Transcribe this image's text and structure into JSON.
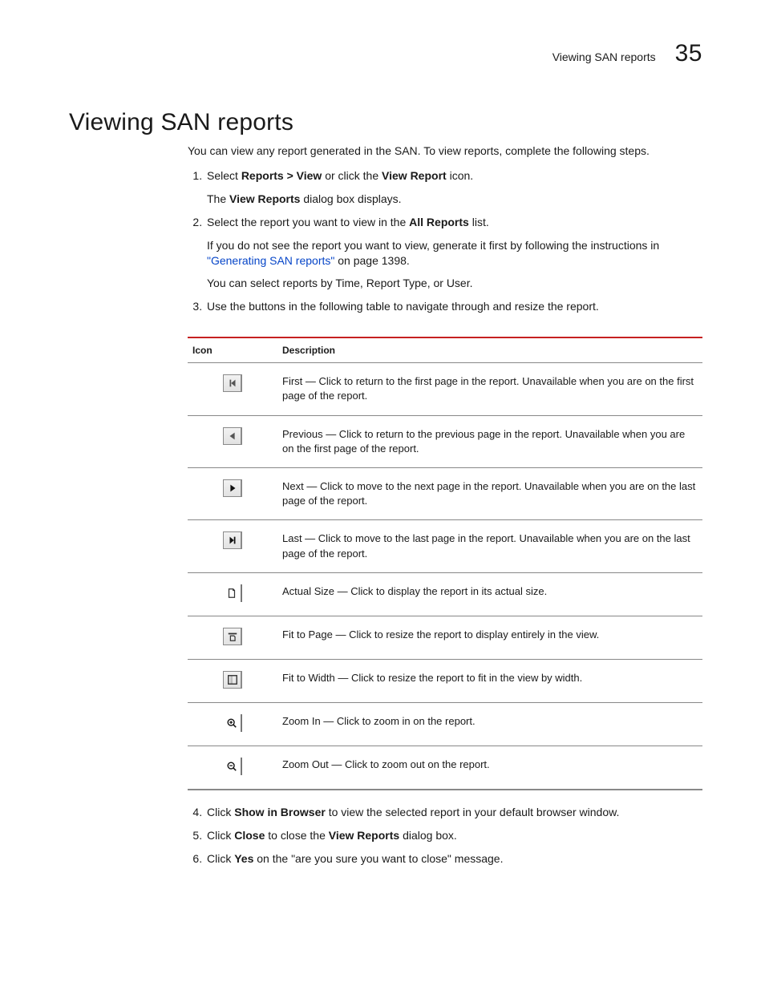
{
  "header": {
    "running_head": "Viewing SAN reports",
    "chapter_number": "35"
  },
  "title": "Viewing SAN reports",
  "intro": "You can view any report generated in the SAN. To view reports, complete the following steps.",
  "steps_part1": {
    "s1_a": "Select ",
    "s1_b": "Reports > View",
    "s1_c": " or click the ",
    "s1_d": "View Report",
    "s1_e": " icon.",
    "s1_f": "The ",
    "s1_g": "View Reports",
    "s1_h": " dialog box displays.",
    "s2_a": "Select the report you want to view in the ",
    "s2_b": "All Reports",
    "s2_c": " list.",
    "s2_d": "If you do not see the report you want to view, generate it first by following the instructions in ",
    "s2_link": "\"Generating SAN reports\"",
    "s2_e": " on page 1398.",
    "s2_f": "You can select reports by Time, Report Type, or User.",
    "s3": "Use the buttons in the following table to navigate through and resize the report."
  },
  "table": {
    "head_icon": "Icon",
    "head_desc": "Description",
    "rows": [
      {
        "icon": "first",
        "desc": "First — Click to return to the first page in the report. Unavailable when you are on the first page of the report."
      },
      {
        "icon": "previous",
        "desc": "Previous — Click to return to the previous page in the report. Unavailable when you are on the first page of the report."
      },
      {
        "icon": "next",
        "desc": "Next — Click to move to the next page in the report. Unavailable when you are on the last page of the report."
      },
      {
        "icon": "last",
        "desc": "Last — Click to move to the last page in the report. Unavailable when you are on the last page of the report."
      },
      {
        "icon": "actual",
        "desc": "Actual Size — Click to display the report in its actual size."
      },
      {
        "icon": "fitpage",
        "desc": "Fit to Page — Click to resize the report to display entirely in the view."
      },
      {
        "icon": "fitwidth",
        "desc": "Fit to Width — Click to resize the report to fit in the view by width."
      },
      {
        "icon": "zoomin",
        "desc": "Zoom In — Click to zoom in on the report."
      },
      {
        "icon": "zoomout",
        "desc": "Zoom Out — Click to zoom out on the report."
      }
    ]
  },
  "steps_part2": {
    "s4_a": "Click ",
    "s4_b": "Show in Browser",
    "s4_c": " to view the selected report in your default browser window.",
    "s5_a": "Click ",
    "s5_b": "Close",
    "s5_c": " to close the ",
    "s5_d": "View Reports",
    "s5_e": " dialog box.",
    "s6_a": "Click ",
    "s6_b": "Yes",
    "s6_c": " on the \"are you sure you want to close\" message."
  }
}
